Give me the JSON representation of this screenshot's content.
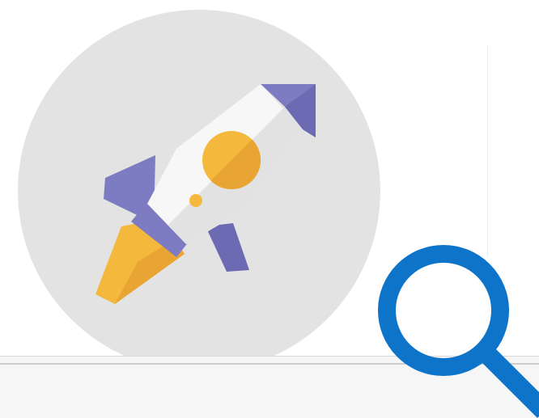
{
  "icons": {
    "app_icon": "rocket-icon",
    "search_icon": "search-icon"
  },
  "colors": {
    "icon_background": "#e3e3e3",
    "rocket_purple": "#7d7cc3",
    "rocket_purple_shade": "#6c6ab3",
    "rocket_body": "#f7f7f7",
    "rocket_body_shade": "#e2e2e2",
    "rocket_flame": "#f4b83c",
    "rocket_flame_shade": "#e9a533",
    "search_blue": "#0d74c9",
    "divider": "#ececec",
    "bottom_bar": "#f6f6f6"
  }
}
